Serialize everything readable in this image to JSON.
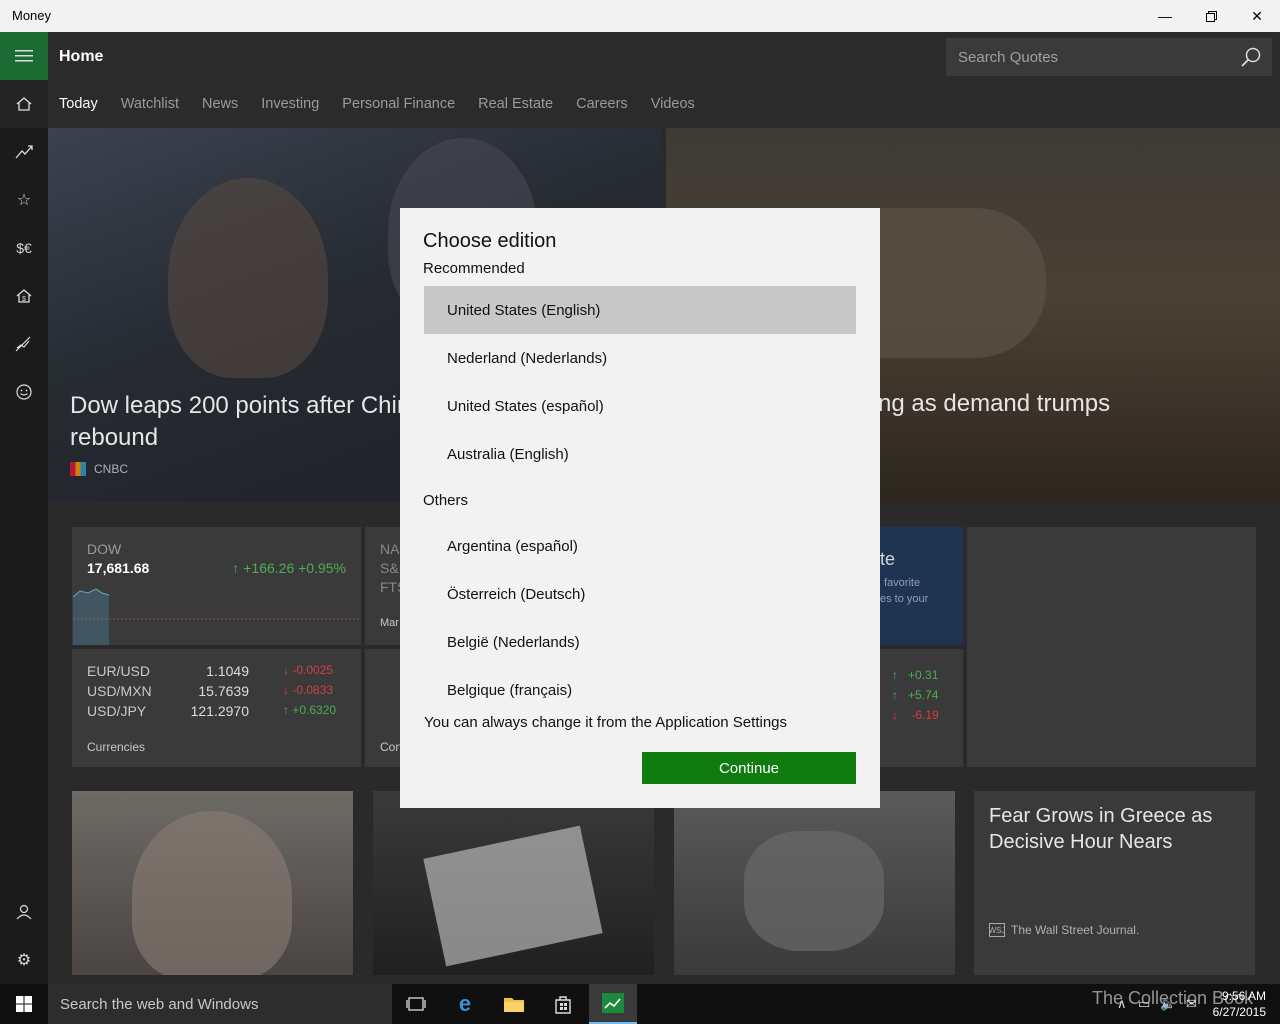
{
  "window": {
    "title": "Money"
  },
  "header": {
    "title": "Home",
    "search_placeholder": "Search Quotes"
  },
  "tabs": [
    {
      "label": "Today"
    },
    {
      "label": "Watchlist"
    },
    {
      "label": "News"
    },
    {
      "label": "Investing"
    },
    {
      "label": "Personal Finance"
    },
    {
      "label": "Real Estate"
    },
    {
      "label": "Careers"
    },
    {
      "label": "Videos"
    }
  ],
  "hero": {
    "left_headline": "Dow leaps 200 points after Chir\nrebound",
    "left_source": "CNBC",
    "right_headline": "ng as demand trumps"
  },
  "markets": {
    "dow": {
      "name": "DOW",
      "value": "17,681.68",
      "change": "+166.26",
      "percent": "+0.95%"
    },
    "index_partial": [
      "NA",
      "S&",
      "FTS"
    ],
    "index_partial_label": "Mar",
    "currencies": [
      {
        "pair": "EUR/USD",
        "value": "1.1049",
        "change": "-0.0025",
        "dir": "down"
      },
      {
        "pair": "USD/MXN",
        "value": "15.7639",
        "change": "-0.0833",
        "dir": "down"
      },
      {
        "pair": "USD/JPY",
        "value": "121.2970",
        "change": "+0.6320",
        "dir": "up"
      }
    ],
    "currencies_label": "Currencies",
    "cur_partial_label": "Con",
    "promo": {
      "title": "te",
      "line1": "favorite",
      "line2": "es to your"
    },
    "right_changes": [
      {
        "value": "+0.31",
        "dir": "up"
      },
      {
        "value": "+5.74",
        "dir": "up"
      },
      {
        "value": "-6.19",
        "dir": "down"
      }
    ]
  },
  "news_card": {
    "headline": "Fear Grows in Greece as Decisive Hour Nears",
    "source": "The Wall Street Journal.",
    "source_logo": "WSJ"
  },
  "dialog": {
    "title": "Choose edition",
    "recommended_label": "Recommended",
    "recommended": [
      "United States (English)",
      "Nederland (Nederlands)",
      "United States (español)",
      "Australia (English)"
    ],
    "others_label": "Others",
    "others": [
      "Argentina (español)",
      "Österreich (Deutsch)",
      "België (Nederlands)",
      "Belgique (français)"
    ],
    "hint": "You can always change it from the Application Settings",
    "continue_label": "Continue"
  },
  "taskbar": {
    "search_placeholder": "Search the web and Windows",
    "watermark": "The Collection Book",
    "time": "9:56 AM",
    "date": "6/27/2015"
  }
}
